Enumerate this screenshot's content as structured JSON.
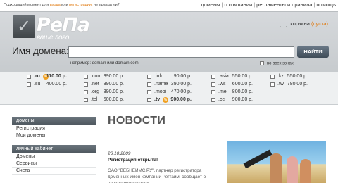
{
  "topbar": {
    "promo_prefix": "Подходящий момент для ",
    "promo_link1": "входа",
    "promo_mid": " или ",
    "promo_link2": "регистрации",
    "promo_suffix": ", не правда ли?",
    "nav": [
      "домены",
      "о компании",
      "регламенты и правила",
      "помощь"
    ]
  },
  "logo": {
    "name": "РеПа",
    "tagline": "ваше лого"
  },
  "cart": {
    "label": "корзина",
    "status": "(пуста)"
  },
  "search": {
    "label": "Имя домена:",
    "value": "",
    "button": "НАЙТИ",
    "hint": "например: domain или domain.com",
    "all_zones": "во всех зонах"
  },
  "zones": [
    {
      "zone": ".ru",
      "price": "110.00 р.",
      "hot": true
    },
    {
      "zone": ".su",
      "price": "400.00 р."
    },
    {
      "zone": ".com",
      "price": "390.00 р."
    },
    {
      "zone": ".net",
      "price": "390.00 р."
    },
    {
      "zone": ".org",
      "price": "390.00 р."
    },
    {
      "zone": ".tel",
      "price": "600.00 р."
    },
    {
      "zone": ".info",
      "price": "90.00 р."
    },
    {
      "zone": ".name",
      "price": "390.00 р."
    },
    {
      "zone": ".mobi",
      "price": "470.00 р."
    },
    {
      "zone": ".tv",
      "price": "900.00 р.",
      "hot": true
    },
    {
      "zone": ".asia",
      "price": "550.00 р."
    },
    {
      "zone": ".ws",
      "price": "600.00 р."
    },
    {
      "zone": ".me",
      "price": "800.00 р."
    },
    {
      "zone": ".cc",
      "price": "900.00 р."
    },
    {
      "zone": ".kz",
      "price": "550.00 р."
    },
    {
      "zone": ".tw",
      "price": "780.00 р."
    }
  ],
  "sidebar": {
    "domains_head": "домены",
    "domains_items": [
      "Регистрация",
      "Мои домены"
    ],
    "cabinet_head": "личный кабинет",
    "cabinet_items": [
      "Домены",
      "Сервисы",
      "Счета"
    ]
  },
  "news": {
    "title": "НОВОСТИ",
    "date": "26.10.2009",
    "headline": "Регистрация открыта!",
    "text": "ОАО \"ВЕБНЕЙМС.РУ\", партнер регистратора доменных имен компании Регтайм, сообщает о начале регистрации"
  },
  "colors": {
    "accent": "#e07a10",
    "header_bg": "#d0d3d6",
    "button": "#4f5c68"
  }
}
